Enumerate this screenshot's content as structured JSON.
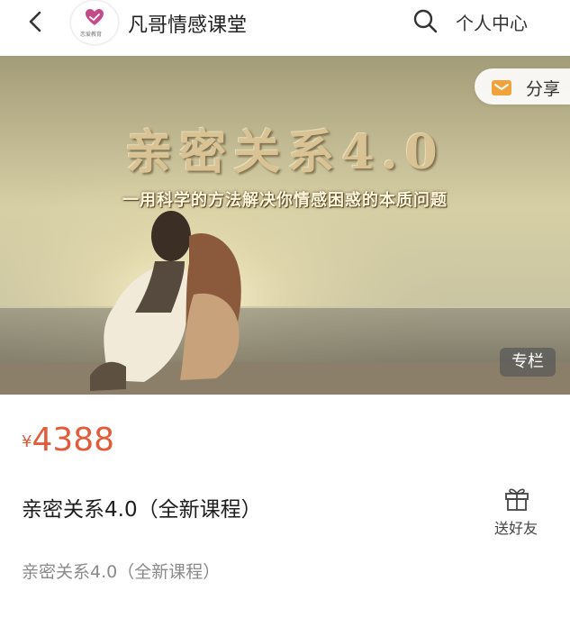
{
  "header": {
    "shop_name": "凡哥情感课堂",
    "personal_center": "个人中心",
    "logo_text": "恋爱教育"
  },
  "banner": {
    "title": "亲密关系4.0",
    "subtitle": "一用科学的方法解决你情感困惑的本质问题",
    "share_label": "分享",
    "tag": "专栏"
  },
  "product": {
    "currency": "¥",
    "price": "4388",
    "title": "亲密关系4.0（全新课程）",
    "subtitle": "亲密关系4.0（全新课程）",
    "gift_label": "送好友"
  },
  "colors": {
    "price": "#e25b3b",
    "share_icon": "#f0a33a"
  }
}
